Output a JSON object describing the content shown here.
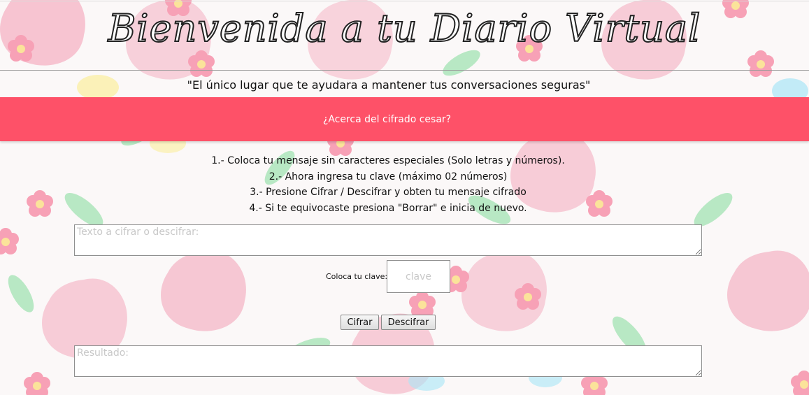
{
  "header": {
    "title": "Bienvenida a tu Diario Virtual",
    "tagline": "\"El único lugar que te ayudara a mantener tus conversaciones seguras\""
  },
  "banner": {
    "link_label": "¿Acerca del cifrado cesar?"
  },
  "instructions": [
    "1.- Coloca tu mensaje sin caracteres especiales (Solo letras y números).",
    "2.- Ahora ingresa tu clave (máximo 02 números)",
    "3.- Presione Cifrar / Descifrar y obten tu mensaje cifrado",
    "4.- Si te equivocaste presiona \"Borrar\" e inicia de nuevo."
  ],
  "form": {
    "input_placeholder": "Texto a cifrar o descifrar:",
    "input_value": "",
    "key_label": "Coloca tu clave:",
    "key_placeholder": "clave",
    "key_value": "",
    "cifrar_label": "Cifrar",
    "descifrar_label": "Descifrar",
    "result_placeholder": "Resultado:",
    "result_value": ""
  },
  "colors": {
    "banner": "#fe5168",
    "flower_pink": "#f7a1b6",
    "leaf_green": "#9fe0b0"
  }
}
